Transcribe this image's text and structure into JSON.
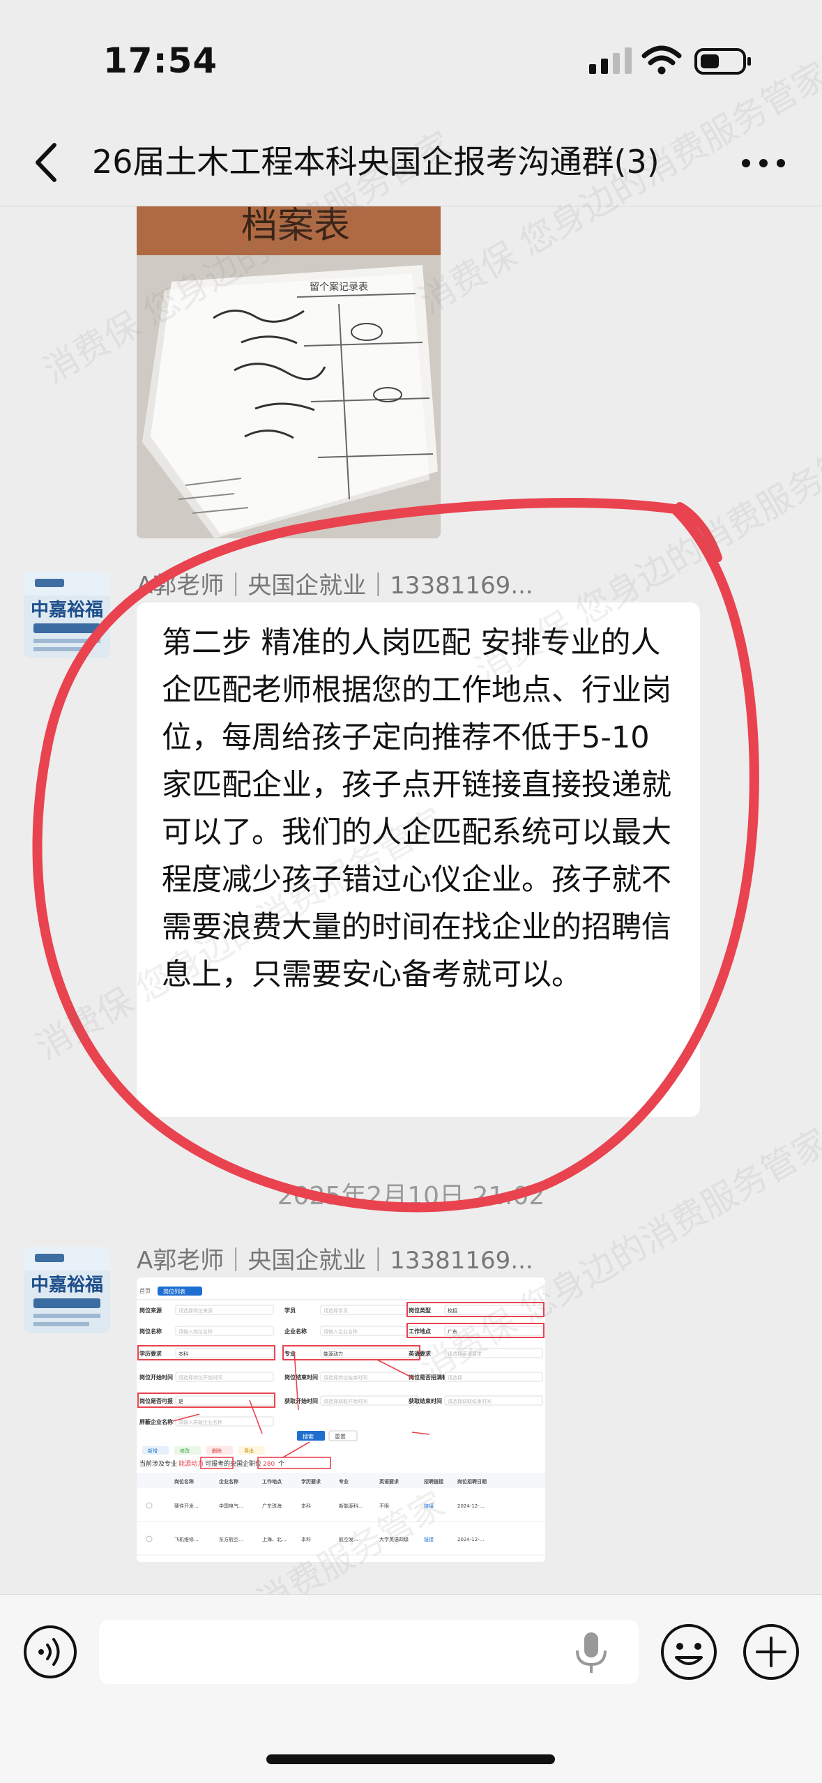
{
  "status_bar": {
    "time": "17:54"
  },
  "header": {
    "title": "26届土木工程本科央国企报考沟通群(3)"
  },
  "messages": [
    {
      "sender": "A郭老师｜央国企就业｜13381169...",
      "avatar_text": "中嘉裕福",
      "text": "第二步 精准的人岗匹配    安排专业的人企匹配老师根据您的工作地点、行业岗位，每周给孩子定向推荐不低于5-10家匹配企业，孩子点开链接直接投递就可以了。我们的人企匹配系统可以最大程度减少孩子错过心仪企业。孩子就不需要浪费大量的时间在找企业的招聘信息上，只需要安心备考就可以。"
    },
    {
      "sender": "A郭老师｜央国企就业｜13381169...",
      "avatar_text": "中嘉裕福"
    }
  ],
  "timestamp": "2025年2月10日 21:02",
  "document_photo": {
    "title_text": "档案表",
    "form_title": "留个案记录表"
  },
  "screenshot": {
    "tab_home": "首页",
    "tab_active": "岗位列表",
    "filters": [
      {
        "label": "岗位来源",
        "placeholder": "请选择岗位来源"
      },
      {
        "label": "学员",
        "placeholder": "请选择学员"
      },
      {
        "label": "岗位类型",
        "value": "校招"
      },
      {
        "label": "岗位名称",
        "placeholder": "请输入岗位名称"
      },
      {
        "label": "企业名称",
        "placeholder": "请输入企业名称"
      },
      {
        "label": "工作地点",
        "value": "广东"
      },
      {
        "label": "学历要求",
        "value": "本科"
      },
      {
        "label": "专业",
        "value": "能源动力"
      },
      {
        "label": "英语要求",
        "placeholder": "请选择英语要求"
      },
      {
        "label": "岗位开始时间",
        "placeholder": "请选择岗位开始时间"
      },
      {
        "label": "岗位结束时间",
        "placeholder": "请选择岗位结束时间"
      },
      {
        "label": "岗位是否招满截止",
        "placeholder": "请选择"
      },
      {
        "label": "岗位是否可报",
        "value": "是"
      },
      {
        "label": "获取开始时间",
        "placeholder": "请选择获取开始时间"
      },
      {
        "label": "获取结束时间",
        "placeholder": "请选择获取结束时间"
      },
      {
        "label": "屏蔽企业名称",
        "placeholder": "请输入屏蔽企业名称"
      }
    ],
    "search_btn": "搜索",
    "reset_btn": "重置",
    "action_buttons": [
      "新增",
      "修改",
      "删除",
      "导出"
    ],
    "summary_prefix": "当前涉及专业",
    "summary_major": "能源动力",
    "summary_middle": "可报考的央国企职位",
    "summary_count": "280",
    "summary_suffix": "个",
    "table_headers": [
      "岗位名称",
      "企业名称",
      "工作地点",
      "学历要求",
      "专业",
      "英语要求",
      "招聘链接",
      "岗位招聘日期"
    ],
    "rows": [
      [
        "硬件开发...",
        "中国电气...",
        "广东珠海",
        "本科",
        "新能源科...",
        "不限",
        "链接",
        "2024-12-..."
      ],
      [
        "飞机维修...",
        "东方航空...",
        "上海、北...",
        "本科",
        "航空发...",
        "大学英语四级",
        "链接",
        "2024-12-..."
      ]
    ]
  },
  "watermark_text": "消费保 您身边的消费服务管家",
  "colors": {
    "accent_red": "#e8434f",
    "link_blue": "#1f6fd1",
    "bubble_bg": "#ffffff",
    "chat_bg": "#ededed"
  }
}
